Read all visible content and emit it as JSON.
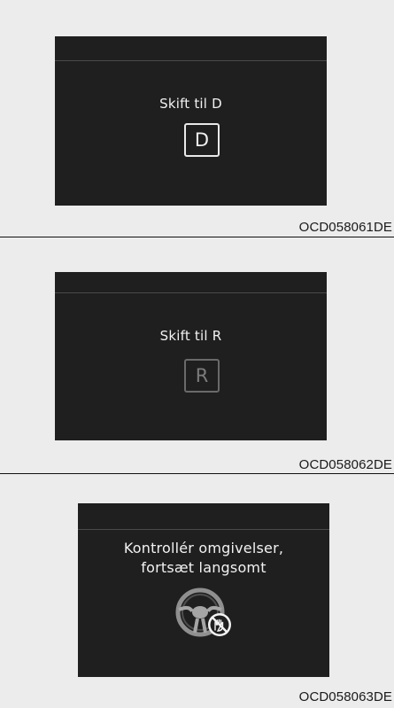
{
  "panels": [
    {
      "message": "Skift til D",
      "gear": "D",
      "code": "OCD058061DE"
    },
    {
      "message": "Skift til R",
      "gear": "R",
      "code": "OCD058062DE"
    },
    {
      "message_line1": "Kontrollér omgivelser,",
      "message_line2": "fortsæt langsomt",
      "icon": "steering-wheel-hands-off-icon",
      "code": "OCD058063DE"
    }
  ],
  "colors": {
    "screen_bg": "#1f1f1f",
    "panel_bg": "#ececec",
    "text": "#f2f2f2",
    "gear_inactive": "#7c7c7c"
  }
}
